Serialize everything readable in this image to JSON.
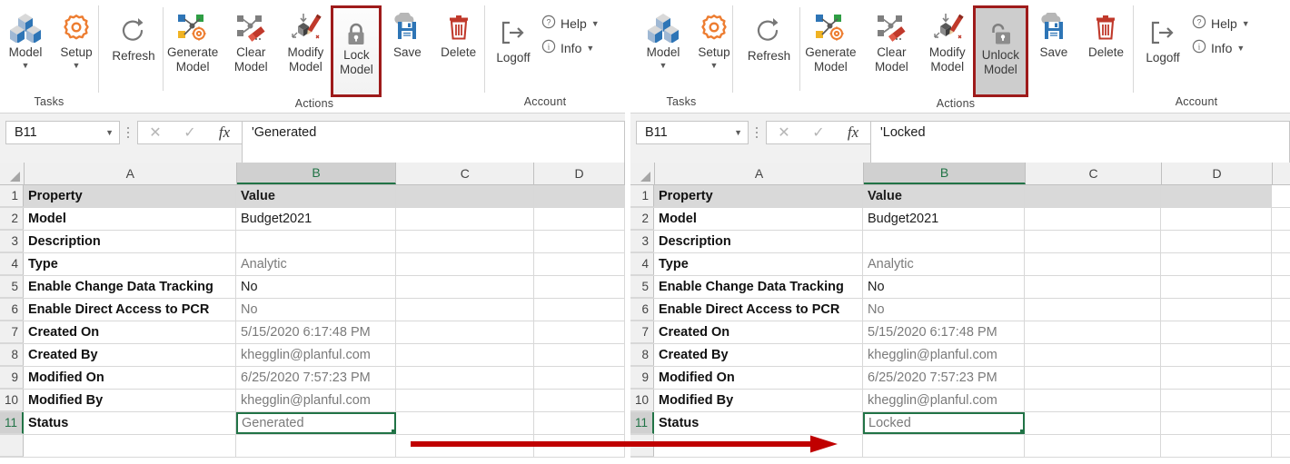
{
  "ribbon": {
    "groups": [
      {
        "label": "Tasks",
        "buttons": [
          {
            "label": "Model",
            "icon": "cubes-icon",
            "dropdown": true
          },
          {
            "label": "Setup",
            "icon": "gear-icon",
            "dropdown": true
          }
        ]
      },
      {
        "label": "Actions",
        "buttons": [
          {
            "label": "Refresh",
            "icon": "refresh-icon"
          },
          {
            "label": "Generate\nModel",
            "icon": "generate-model-icon"
          },
          {
            "label": "Clear\nModel",
            "icon": "clear-model-icon"
          },
          {
            "label": "Modify\nModel",
            "icon": "modify-model-icon"
          },
          {
            "label_left": "Lock\nModel",
            "label_right": "Unlock\nModel",
            "icon": "lock-icon"
          },
          {
            "label": "Save",
            "icon": "save-icon"
          },
          {
            "label": "Delete",
            "icon": "delete-icon"
          }
        ]
      },
      {
        "label": "Account",
        "buttons": [
          {
            "label": "Logoff",
            "icon": "logoff-icon"
          }
        ],
        "links": [
          {
            "label": "Help",
            "icon": "help-icon",
            "dropdown": true
          },
          {
            "label": "Info",
            "icon": "info-icon",
            "dropdown": true
          }
        ]
      }
    ]
  },
  "left": {
    "namebox": "B11",
    "formula": "'Generated",
    "columns": [
      "A",
      "B",
      "C",
      "D"
    ],
    "selected_column": "B",
    "selected_row": "11",
    "rows": [
      {
        "n": "1",
        "a": "Property",
        "b": "Value"
      },
      {
        "n": "2",
        "a": "Model",
        "b": "Budget2021"
      },
      {
        "n": "3",
        "a": "Description",
        "b": ""
      },
      {
        "n": "4",
        "a": "Type",
        "b": "Analytic"
      },
      {
        "n": "5",
        "a": "Enable Change Data Tracking",
        "b": "No"
      },
      {
        "n": "6",
        "a": "Enable Direct Access to PCR",
        "b": "No"
      },
      {
        "n": "7",
        "a": "Created On",
        "b": "5/15/2020 6:17:48 PM"
      },
      {
        "n": "8",
        "a": "Created By",
        "b": "khegglin@planful.com"
      },
      {
        "n": "9",
        "a": "Modified On",
        "b": "6/25/2020 7:57:23 PM"
      },
      {
        "n": "10",
        "a": "Modified By",
        "b": "khegglin@planful.com"
      },
      {
        "n": "11",
        "a": "Status",
        "b": "Generated"
      }
    ]
  },
  "right": {
    "namebox": "B11",
    "formula": "'Locked",
    "columns": [
      "A",
      "B",
      "C",
      "D"
    ],
    "selected_column": "B",
    "selected_row": "11",
    "rows": [
      {
        "n": "1",
        "a": "Property",
        "b": "Value"
      },
      {
        "n": "2",
        "a": "Model",
        "b": "Budget2021"
      },
      {
        "n": "3",
        "a": "Description",
        "b": ""
      },
      {
        "n": "4",
        "a": "Type",
        "b": "Analytic"
      },
      {
        "n": "5",
        "a": "Enable Change Data Tracking",
        "b": "No"
      },
      {
        "n": "6",
        "a": "Enable Direct Access to PCR",
        "b": "No"
      },
      {
        "n": "7",
        "a": "Created On",
        "b": "5/15/2020 6:17:48 PM"
      },
      {
        "n": "8",
        "a": "Created By",
        "b": "khegglin@planful.com"
      },
      {
        "n": "9",
        "a": "Modified On",
        "b": "6/25/2020 7:57:23 PM"
      },
      {
        "n": "10",
        "a": "Modified By",
        "b": "khegglin@planful.com"
      },
      {
        "n": "11",
        "a": "Status",
        "b": "Locked"
      }
    ]
  },
  "annotation": {
    "arrow_color": "#c00000"
  },
  "colors": {
    "excel_green": "#217346",
    "highlight_border": "#9e1b1b",
    "accent_orange": "#ed7d31",
    "accent_blue": "#2e75b6",
    "accent_red": "#c0392b"
  }
}
